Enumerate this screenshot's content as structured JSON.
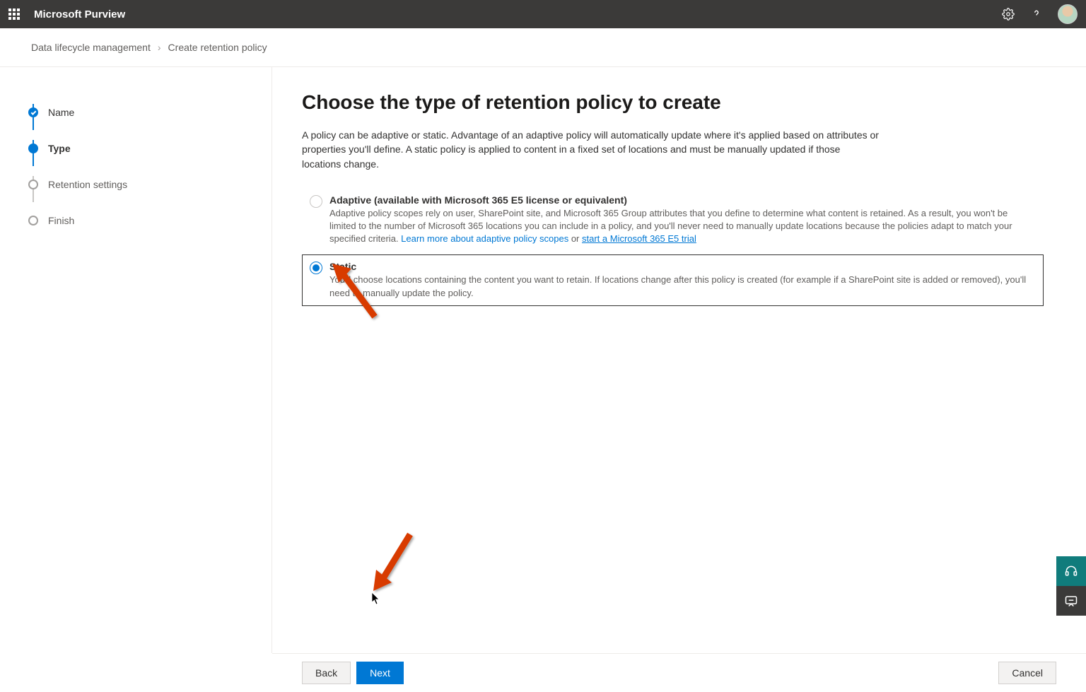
{
  "header": {
    "app_title": "Microsoft Purview"
  },
  "breadcrumb": {
    "items": [
      "Data lifecycle management",
      "Create retention policy"
    ]
  },
  "steps": [
    {
      "label": "Name",
      "state": "completed"
    },
    {
      "label": "Type",
      "state": "current"
    },
    {
      "label": "Retention settings",
      "state": "pending"
    },
    {
      "label": "Finish",
      "state": "pending"
    }
  ],
  "page": {
    "title": "Choose the type of retention policy to create",
    "description": "A policy can be adaptive or static. Advantage of an adaptive policy will automatically update where it's applied based on attributes or properties you'll define. A static policy is applied to content in a fixed set of locations and must be manually updated if those locations change."
  },
  "options": {
    "adaptive": {
      "title": "Adaptive (available with Microsoft 365 E5 license or equivalent)",
      "desc_prefix": "Adaptive policy scopes rely on user, SharePoint site, and Microsoft 365 Group attributes that you define to determine what content is retained. As a result, you won't be limited to the number of Microsoft 365 locations you can include in a policy, and you'll never need to manually update locations because the policies adapt to match your specified criteria. ",
      "link1": "Learn more about adaptive policy scopes",
      "or": " or ",
      "link2": "start a Microsoft 365 E5 trial",
      "selected": false,
      "enabled": false
    },
    "static": {
      "title": "Static",
      "desc": "You'll choose locations containing the content you want to retain. If locations change after this policy is created (for example if a SharePoint site is added or removed), you'll need to manually update the policy.",
      "selected": true
    }
  },
  "footer": {
    "back": "Back",
    "next": "Next",
    "cancel": "Cancel"
  }
}
